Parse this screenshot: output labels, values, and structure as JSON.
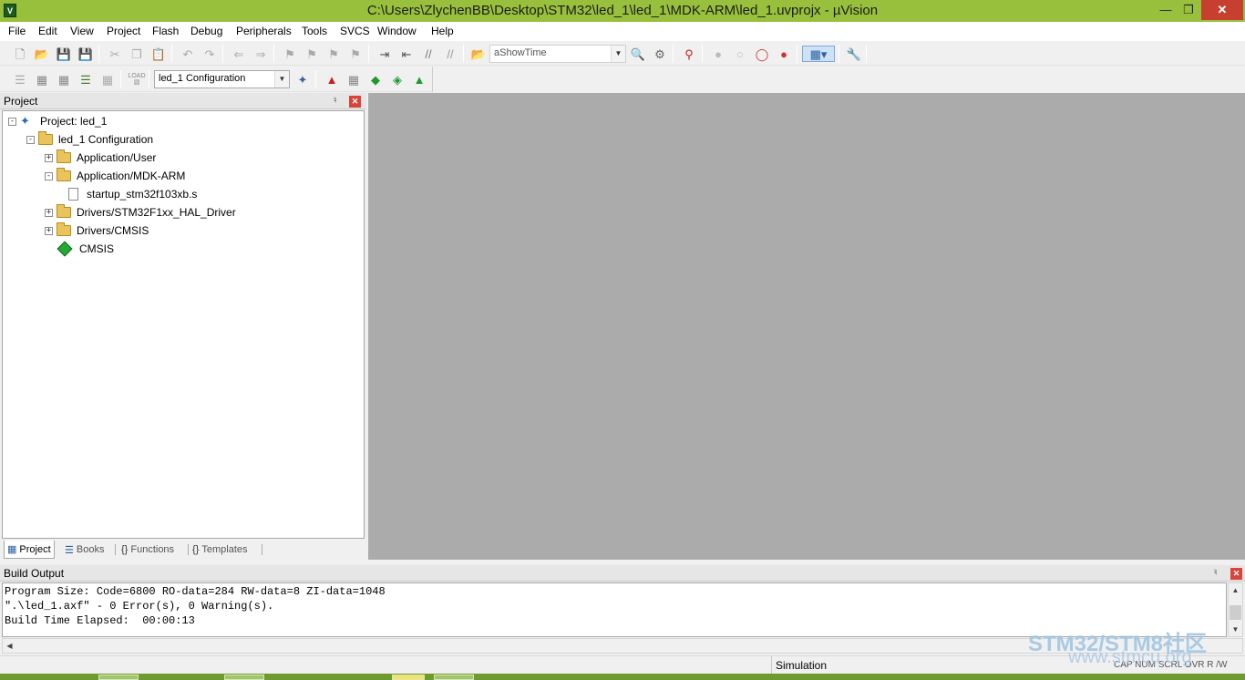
{
  "window": {
    "title": "C:\\Users\\ZlychenBB\\Desktop\\STM32\\led_1\\led_1\\MDK-ARM\\led_1.uvprojx - µVision",
    "app_icon_label": "V"
  },
  "menu": [
    "File",
    "Edit",
    "View",
    "Project",
    "Flash",
    "Debug",
    "Peripherals",
    "Tools",
    "SVCS",
    "Window",
    "Help"
  ],
  "toolbar": {
    "find_combo_value": "aShowTime",
    "target_combo_value": "led_1 Configuration",
    "load_label": "LOAD"
  },
  "project_pane": {
    "title": "Project",
    "tree": {
      "root": "Project: led_1",
      "target": "led_1 Configuration",
      "groups": [
        "Application/User",
        "Application/MDK-ARM",
        "Drivers/STM32F1xx_HAL_Driver",
        "Drivers/CMSIS"
      ],
      "file": "startup_stm32f103xb.s",
      "component": "CMSIS"
    },
    "tabs": [
      "Project",
      "Books",
      "Functions",
      "Templates"
    ]
  },
  "build_output": {
    "title": "Build Output",
    "lines": [
      "Program Size: Code=6800 RO-data=284 RW-data=8 ZI-data=1048",
      "\".\\led_1.axf\" - 0 Error(s), 0 Warning(s).",
      "Build Time Elapsed:  00:00:13"
    ]
  },
  "statusbar": {
    "mode": "Simulation",
    "indicators": "CAP  NUM  SCRL  OVR  R /W"
  },
  "watermark": {
    "line1": "STM32/STM8社区",
    "line2": "www.stmcu.org"
  },
  "colors": {
    "titlebar": "#99c03c",
    "editor_background": "#ababab",
    "close_button": "#c7402f"
  }
}
